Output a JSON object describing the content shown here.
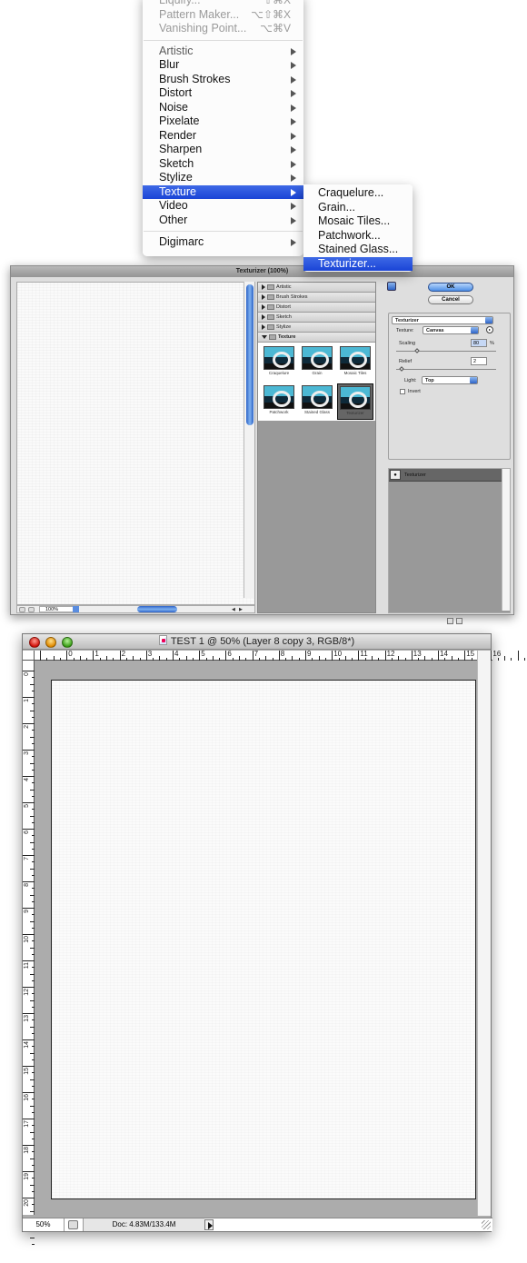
{
  "filter_menu": {
    "top_items": [
      {
        "label": "Liquify...",
        "shortcut": "⇧⌘X",
        "state": "disabled"
      },
      {
        "label": "Pattern Maker...",
        "shortcut": "⌥⇧⌘X",
        "state": "disabled"
      },
      {
        "label": "Vanishing Point...",
        "shortcut": "⌥⌘V",
        "state": "disabled"
      }
    ],
    "categories": [
      {
        "label": "Artistic"
      },
      {
        "label": "Blur"
      },
      {
        "label": "Brush Strokes"
      },
      {
        "label": "Distort"
      },
      {
        "label": "Noise"
      },
      {
        "label": "Pixelate"
      },
      {
        "label": "Render"
      },
      {
        "label": "Sharpen"
      },
      {
        "label": "Sketch"
      },
      {
        "label": "Stylize"
      },
      {
        "label": "Texture",
        "selected": true
      },
      {
        "label": "Video"
      },
      {
        "label": "Other"
      }
    ],
    "bottom_items": [
      {
        "label": "Digimarc"
      }
    ],
    "submenu": [
      {
        "label": "Craquelure..."
      },
      {
        "label": "Grain..."
      },
      {
        "label": "Mosaic Tiles..."
      },
      {
        "label": "Patchwork..."
      },
      {
        "label": "Stained Glass..."
      },
      {
        "label": "Texturizer...",
        "selected": true
      }
    ],
    "highlight_color": "#2851dc"
  },
  "dialog": {
    "title": "Texturizer (100%)",
    "preview_zoom": "100%",
    "gallery": {
      "collapsed_categories": [
        "Artistic",
        "Brush Strokes",
        "Distort",
        "Sketch",
        "Stylize"
      ],
      "open_category": "Texture",
      "thumbnails": [
        {
          "label": "Craquelure"
        },
        {
          "label": "Grain"
        },
        {
          "label": "Mosaic Tiles"
        },
        {
          "label": "Patchwork"
        },
        {
          "label": "Stained Glass"
        },
        {
          "label": "Texturizer",
          "selected": true
        }
      ]
    },
    "buttons": {
      "ok": "OK",
      "cancel": "Cancel"
    },
    "filter_select": "Texturizer",
    "texture_label": "Texture:",
    "texture_value": "Canvas",
    "scaling_label": "Scaling",
    "scaling_value": "80",
    "scaling_unit": "%",
    "relief_label": "Relief",
    "relief_value": "2",
    "light_label": "Light:",
    "light_value": "Top",
    "invert_label": "Invert",
    "invert_checked": false,
    "effect_layers": [
      {
        "name": "Texturizer",
        "visible": true
      }
    ]
  },
  "document": {
    "title": "TEST 1 @ 50% (Layer 8 copy 3, RGB/8*)",
    "h_ruler_labels": [
      "0",
      "1",
      "2",
      "3",
      "4",
      "5",
      "6",
      "7",
      "8",
      "9",
      "10",
      "11",
      "12",
      "13",
      "14",
      "15",
      "16"
    ],
    "v_ruler_labels": [
      "0",
      "1",
      "2",
      "3",
      "4",
      "5",
      "6",
      "7",
      "8",
      "9",
      "10",
      "11",
      "12",
      "13",
      "14",
      "15",
      "16",
      "17",
      "18",
      "19",
      "20"
    ],
    "status": {
      "zoom": "50%",
      "doc_info": "Doc: 4.83M/133.4M"
    }
  }
}
